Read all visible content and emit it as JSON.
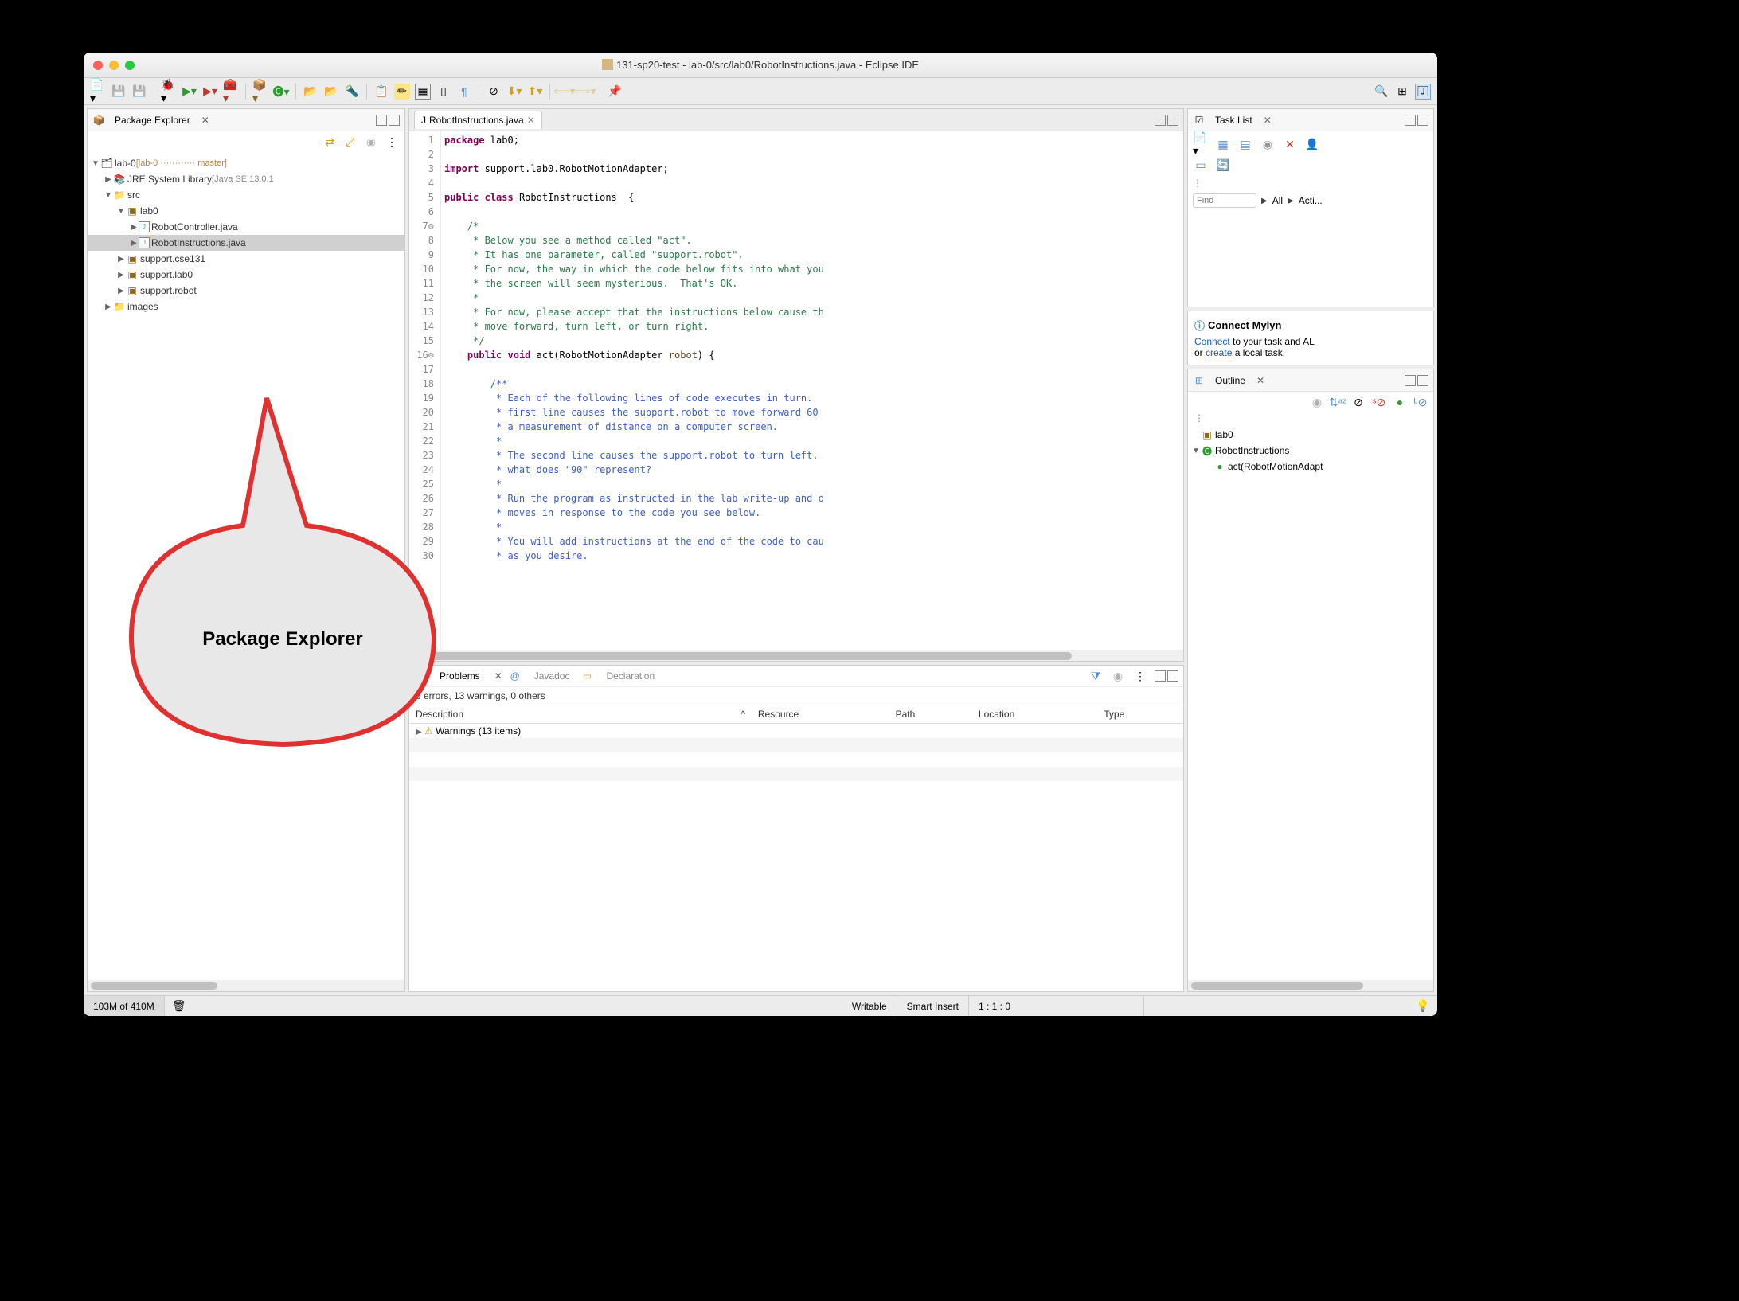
{
  "title": "131-sp20-test - lab-0/src/lab0/RobotInstructions.java - Eclipse IDE",
  "package_explorer": {
    "title": "Package Explorer",
    "project": "lab-0",
    "branch": "[lab-0 ············ master]",
    "jre": "JRE System Library",
    "jre_ver": "[Java SE 13.0.1",
    "src": "src",
    "pkg0": "lab0",
    "file0": "RobotController.java",
    "file1": "RobotInstructions.java",
    "pkg1": "support.cse131",
    "pkg2": "support.lab0",
    "pkg3": "support.robot",
    "images": "images"
  },
  "editor": {
    "tab": "RobotInstructions.java",
    "lines": [
      "1",
      "2",
      "3",
      "4",
      "5",
      "6",
      "7",
      "8",
      "9",
      "10",
      "11",
      "12",
      "13",
      "14",
      "15",
      "16",
      "17",
      "18",
      "19",
      "20",
      "21",
      "22",
      "23",
      "24",
      "25",
      "26",
      "27",
      "28",
      "29",
      "30"
    ],
    "l1a": "package",
    "l1b": " lab0;",
    "l3a": "import",
    "l3b": " support.lab0.RobotMotionAdapter;",
    "l5a": "public",
    "l5b": "class",
    "l5c": " RobotInstructions  {",
    "c7": "    /*",
    "c8": "     * Below you see a method called \"act\".",
    "c9": "     * It has one parameter, called \"support.robot\".",
    "c10": "     * For now, the way in which the code below fits into what you",
    "c11": "     * the screen will seem mysterious.  That's OK.",
    "c12": "     *",
    "c13": "     * For now, please accept that the instructions below cause th",
    "c14": "     * move forward, turn left, or turn right.",
    "c15": "     */",
    "l16a": "public",
    "l16b": "void",
    "l16c": " act(RobotMotionAdapter ",
    "l16d": "robot",
    "l16e": ") {",
    "j18": "        /**",
    "j19": "         * Each of the following lines of code executes in turn.",
    "j20": "         * first line causes the support.robot to move forward 60 ",
    "j21": "         * a measurement of distance on a computer screen.",
    "j22": "         *",
    "j23": "         * The second line causes the support.robot to turn left.",
    "j24": "         * what does \"90\" represent?",
    "j25": "         *",
    "j26": "         * Run the program as instructed in the lab write-up and o",
    "j27": "         * moves in response to the code you see below.",
    "j28": "         *",
    "j29": "         * You will add instructions at the end of the code to cau",
    "j30": "         * as you desire."
  },
  "problems": {
    "tab1": "Problems",
    "tab2": "Javadoc",
    "tab3": "Declaration",
    "summary": "0 errors, 13 warnings, 0 others",
    "col1": "Description",
    "col2": "Resource",
    "col3": "Path",
    "col4": "Location",
    "col5": "Type",
    "row1": "Warnings (13 items)"
  },
  "tasklist": {
    "title": "Task List",
    "find_ph": "Find",
    "all": "All",
    "acti": "Acti..."
  },
  "mylyn": {
    "title": "Connect Mylyn",
    "connect": "Connect",
    "text1": " to your task and AL",
    "text2": "or ",
    "create": "create",
    "text3": " a local task."
  },
  "outline": {
    "title": "Outline",
    "pkg": "lab0",
    "cls": "RobotInstructions",
    "method": "act(RobotMotionAdapt"
  },
  "status": {
    "mem": "103M of 410M",
    "writable": "Writable",
    "insert": "Smart Insert",
    "pos": "1 : 1 : 0"
  },
  "callout": "Package Explorer"
}
